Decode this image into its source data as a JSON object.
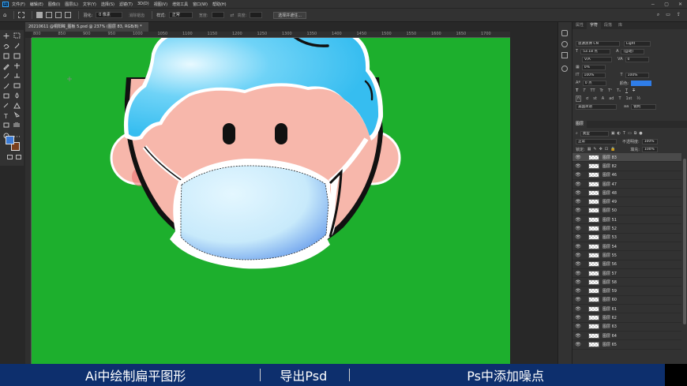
{
  "menubar": {
    "app_icon": "Ps",
    "items": [
      "文件(F)",
      "编辑(E)",
      "图像(I)",
      "图层(L)",
      "文字(Y)",
      "选择(S)",
      "滤镜(T)",
      "3D(D)",
      "视图(V)",
      "增效工具",
      "窗口(W)",
      "帮助(H)"
    ],
    "window_controls": [
      "−",
      "▢",
      "✕"
    ]
  },
  "optionbar": {
    "feather_label": "羽化:",
    "feather_value": "0 像素",
    "antialias_label": "消除锯齿",
    "style_label": "样式:",
    "style_value": "正常",
    "width_label": "宽度:",
    "height_label": "高度:",
    "select_mask_button": "选择并遮住..."
  },
  "document": {
    "tab_title": "20210611 @桐阳眸_图板 5.psd @ 237% (图层 83, RGB/8) *",
    "ruler_top_ticks": [
      "800",
      "850",
      "900",
      "950",
      "1000",
      "1050",
      "1100",
      "1150",
      "1200",
      "1250",
      "1300",
      "1350",
      "1400",
      "1450",
      "1500",
      "1550",
      "1600",
      "1650",
      "1700"
    ],
    "canvas_color": "#1daf2d"
  },
  "character_panel": {
    "tabs": [
      "属性",
      "字符",
      "段落",
      "库"
    ],
    "active_tab": "字符",
    "font_family": "思源黑体 CN",
    "font_style": "Light",
    "font_size": "53.18 点",
    "leading": "(自动)",
    "kerning": "V/A",
    "tracking": "0",
    "scale_pct": "0%",
    "vertical_scale": "100%",
    "horizontal_scale": "100%",
    "baseline": "0 点",
    "color_label": "颜色:",
    "text_color": "#2f7de8",
    "style_buttons": [
      "T",
      "T",
      "TT",
      "Tr",
      "T¹",
      "T₁",
      "T",
      "T"
    ],
    "opentype_buttons": [
      "fi",
      "ơ",
      "st",
      "A",
      "ad",
      "T",
      "1st",
      "½"
    ],
    "language": "美国英语",
    "antialias": "锐利",
    "aa_prefix": "aa"
  },
  "layers_panel": {
    "tab": "图层",
    "filter_label": "类型",
    "blend_mode": "正常",
    "opacity_label": "不透明度:",
    "opacity_value": "100%",
    "lock_label": "锁定:",
    "fill_label": "填充:",
    "fill_value": "100%",
    "layers": [
      "图层 83",
      "图层 82",
      "图层 46",
      "图层 47",
      "图层 48",
      "图层 49",
      "图层 50",
      "图层 51",
      "图层 52",
      "图层 53",
      "图层 54",
      "图层 55",
      "图层 56",
      "图层 57",
      "图层 58",
      "图层 59",
      "图层 60",
      "图层 61",
      "图层 62",
      "图层 63",
      "图层 64",
      "图层 65"
    ],
    "selected_layer": "图层 83"
  },
  "caption": {
    "items": [
      "Ai中绘制扁平图形",
      "导出Psd",
      "Ps中添加噪点"
    ]
  },
  "colors": {
    "hair": "#3ec1f3",
    "skin": "#f7b7ab",
    "mask": "#cdeefc",
    "foreground": "#3a7bd5",
    "background": "#7a3f1c",
    "caption_bg": "#0d2f6d"
  }
}
